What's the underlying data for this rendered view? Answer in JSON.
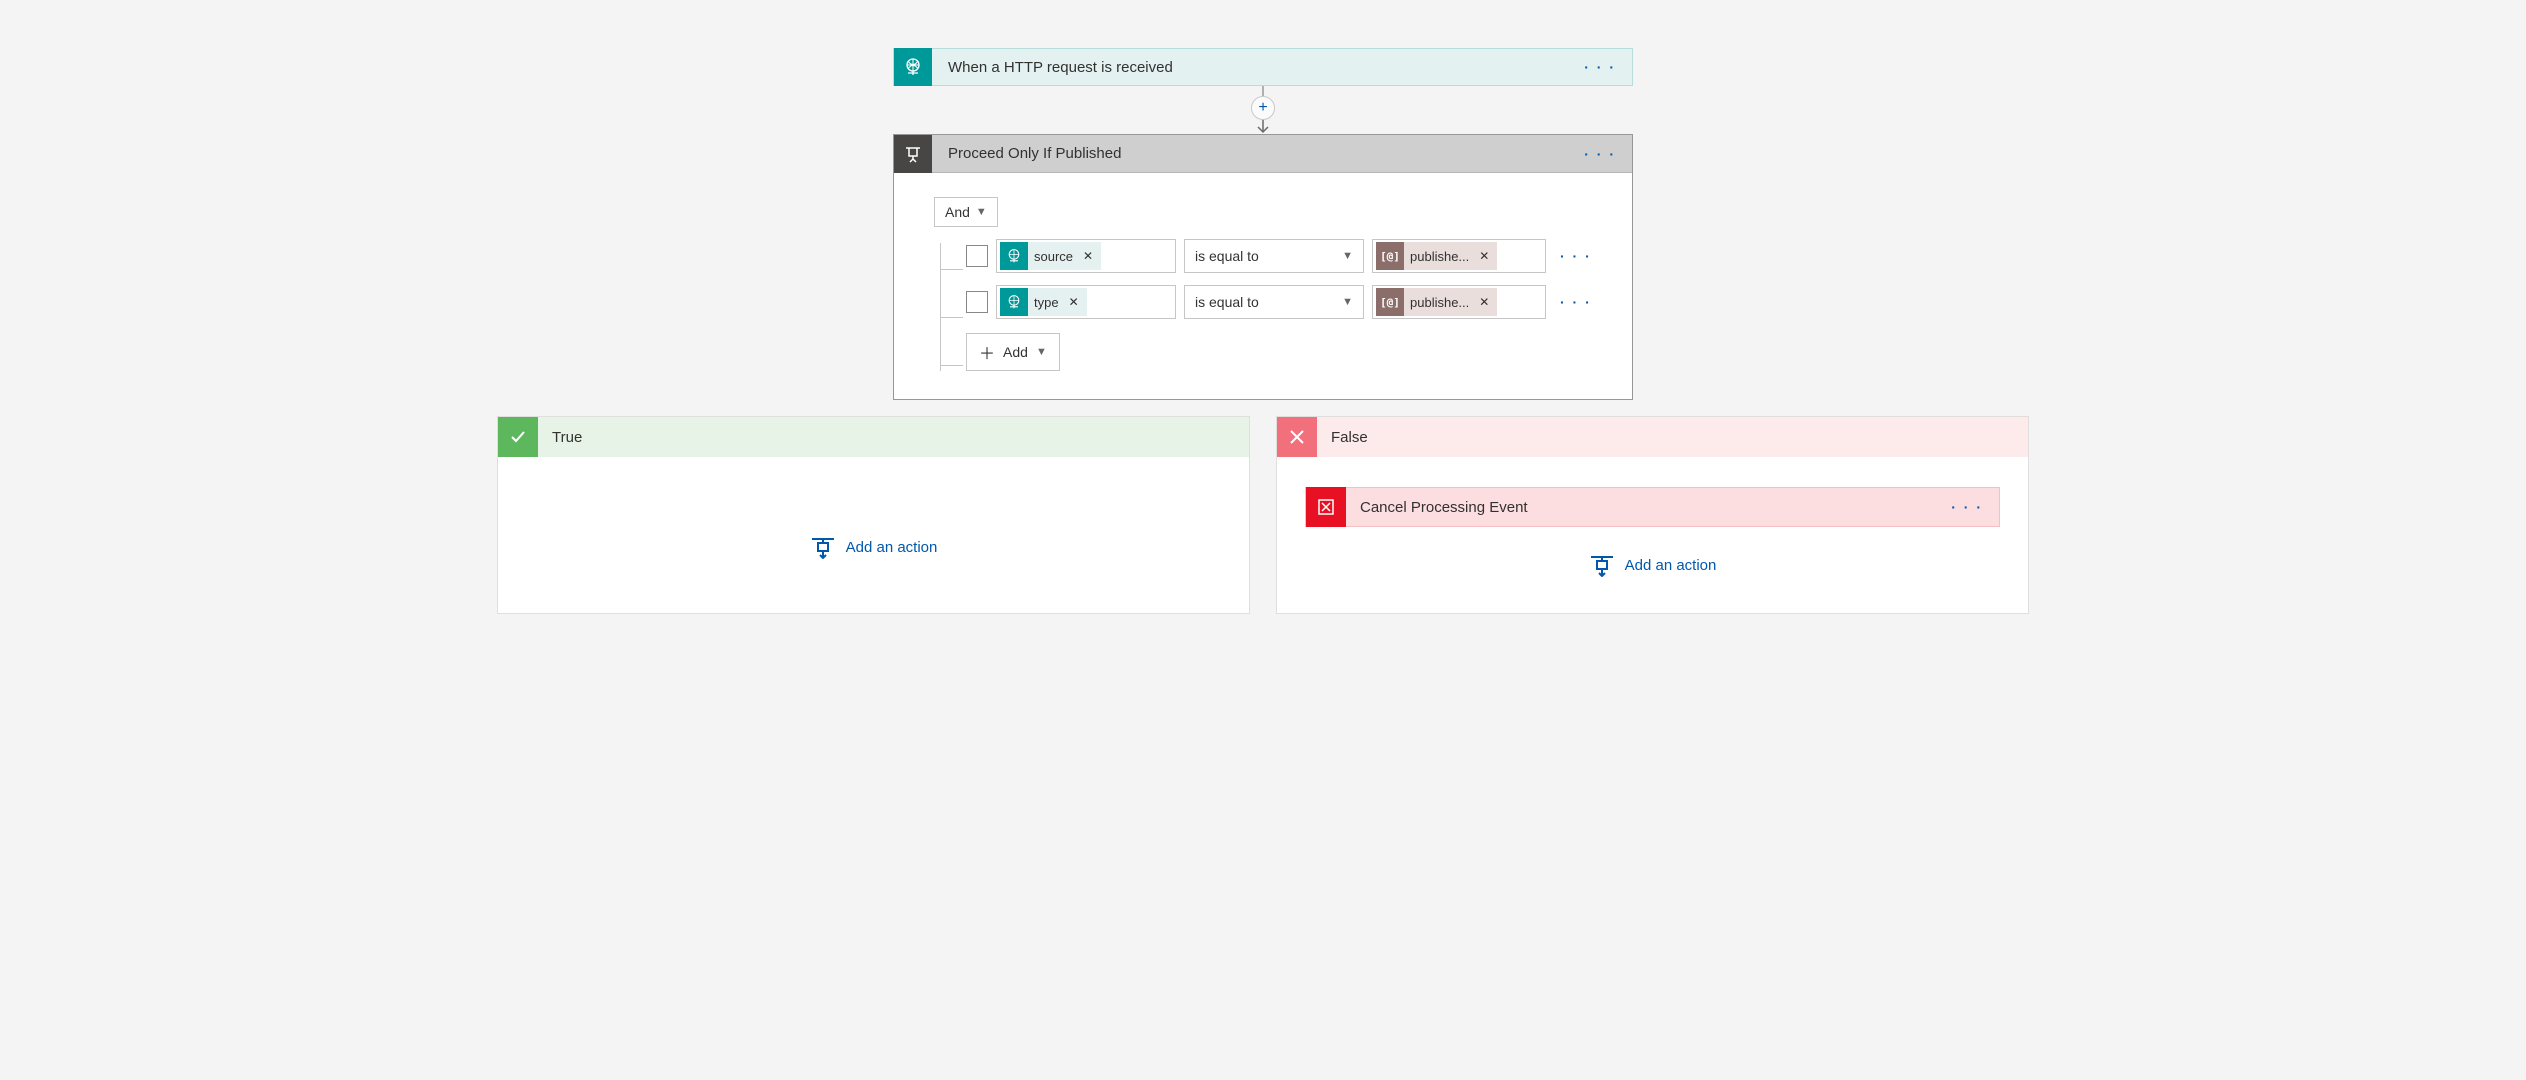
{
  "trigger": {
    "title": "When a HTTP request is received"
  },
  "menu_dots": "· · ·",
  "condition": {
    "title": "Proceed Only If Published",
    "logical_op": "And",
    "add_label": "Add",
    "rows": [
      {
        "left_token": "source",
        "op": "is equal to",
        "right_token": "publishe...",
        "right_icon_text": "[@]"
      },
      {
        "left_token": "type",
        "op": "is equal to",
        "right_token": "publishe...",
        "right_icon_text": "[@]"
      }
    ]
  },
  "branch_true": {
    "title": "True",
    "add_action": "Add an action"
  },
  "branch_false": {
    "title": "False",
    "add_action": "Add an action",
    "cancel_card": {
      "title": "Cancel Processing Event"
    }
  }
}
